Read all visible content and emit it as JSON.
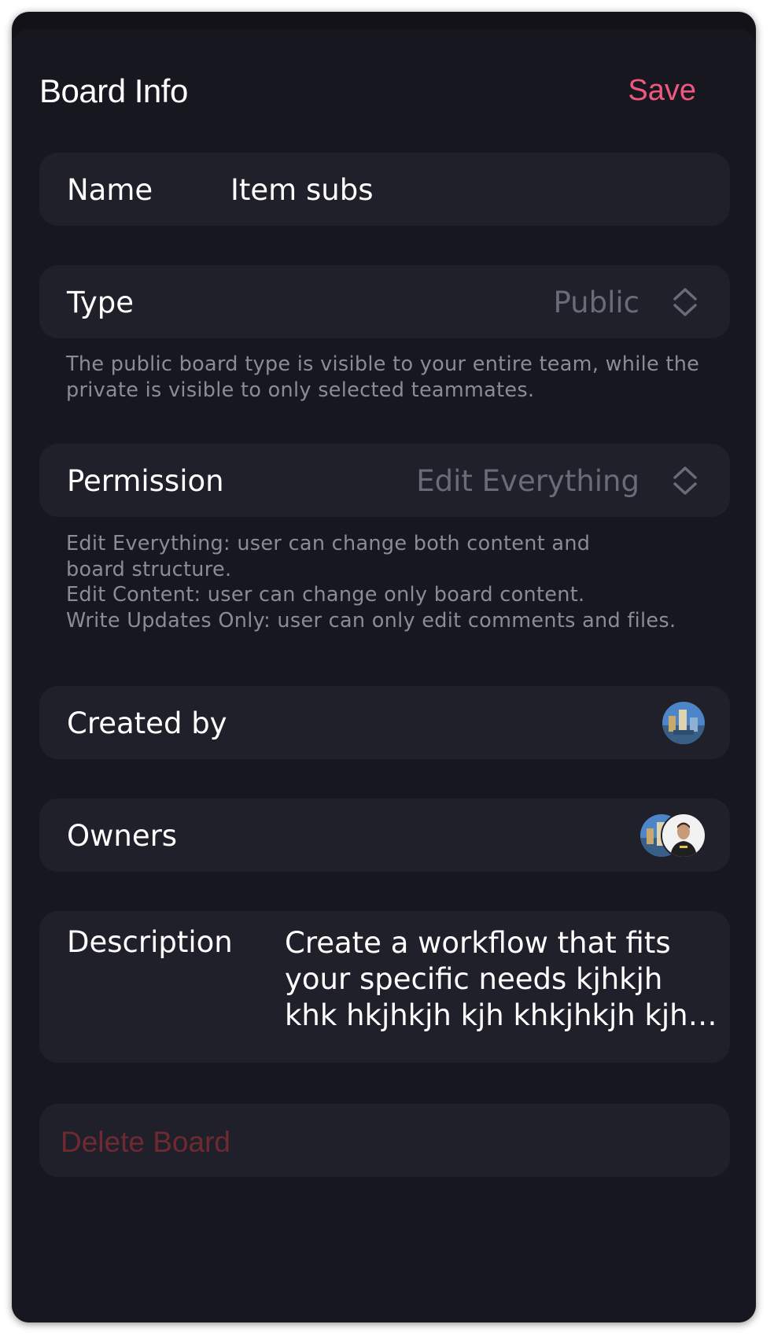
{
  "header": {
    "title": "Board Info",
    "save_label": "Save"
  },
  "name_row": {
    "label": "Name",
    "value": "Item subs"
  },
  "type_row": {
    "label": "Type",
    "value": "Public",
    "hint_lines": [
      "The public board type is visible to your entire team, while the",
      "private is visible to only selected teammates."
    ]
  },
  "permission_row": {
    "label": "Permission",
    "value": "Edit Everything",
    "hint_lines": [
      "Edit Everything: user can change both content and",
      "board structure.",
      "Edit Content: user can change only board content.",
      "Write Updates Only: user can only edit comments and files."
    ]
  },
  "created_by_row": {
    "label": "Created by",
    "avatar_icon": "user-avatar-icon"
  },
  "owners_row": {
    "label": "Owners",
    "avatar_icons": [
      "user-avatar-icon",
      "user-avatar-icon"
    ]
  },
  "description_row": {
    "label": "Description",
    "lines": [
      "Create a workflow that fits",
      "your specific needs kjhkjh",
      "khk hkjhkjh kjh khkjhkjh kjh…"
    ]
  },
  "delete_row": {
    "label": "Delete Board"
  },
  "colors": {
    "accent": "#f0587e",
    "background": "#17171f",
    "card": "#20202b",
    "muted_text": "#6a6a78",
    "hint_text": "#8b8b99",
    "danger_dim": "#6e2a30"
  }
}
